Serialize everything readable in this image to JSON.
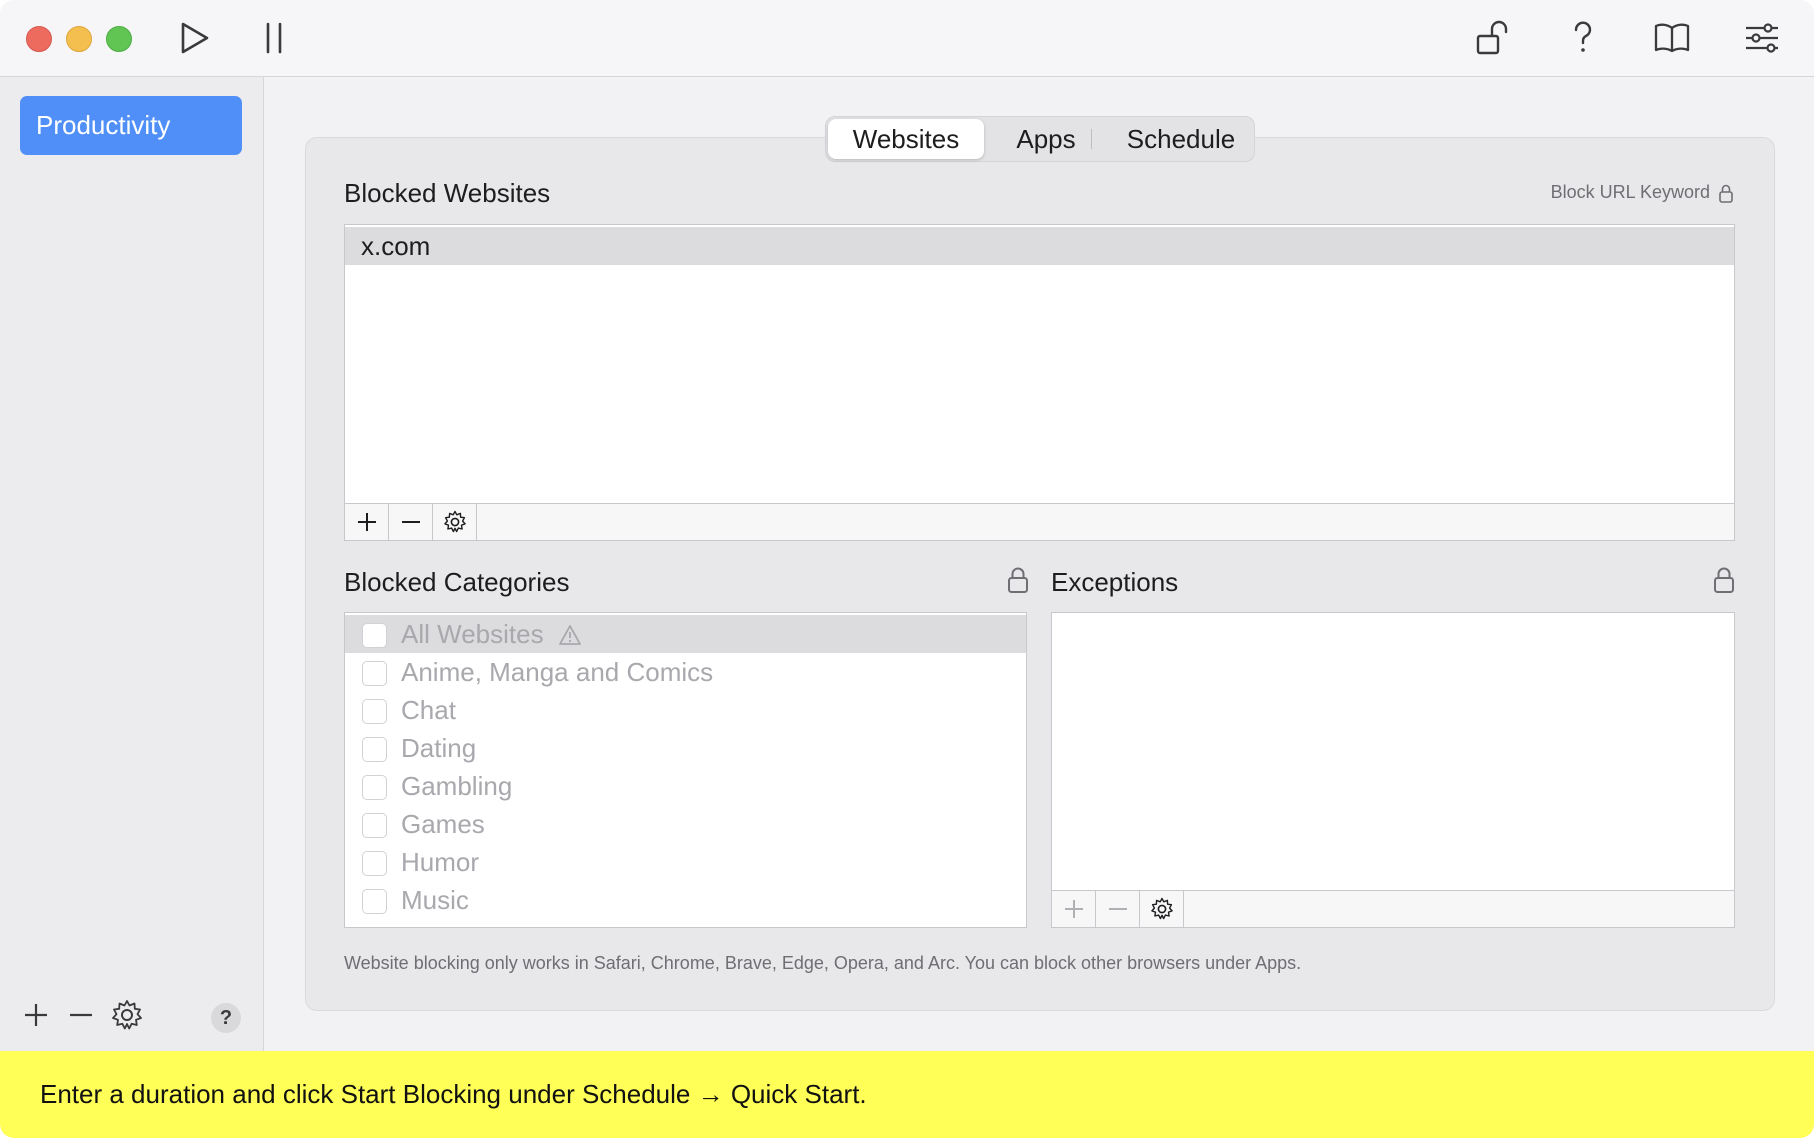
{
  "toolbar": {
    "icons": [
      "play-icon",
      "pause-icon",
      "unlock-icon",
      "help-icon",
      "book-icon",
      "sliders-icon"
    ]
  },
  "sidebar": {
    "items": [
      {
        "label": "Productivity",
        "selected": true
      }
    ],
    "footer_icons": [
      "plus-icon",
      "minus-icon",
      "gear-icon",
      "help-icon"
    ],
    "help_label": "?"
  },
  "tabs": {
    "items": [
      "Websites",
      "Apps",
      "Schedule"
    ],
    "active": "Websites"
  },
  "blocked_websites": {
    "title": "Blocked Websites",
    "keyword_label": "Block URL Keyword",
    "rows": [
      "x.com"
    ]
  },
  "blocked_categories": {
    "title": "Blocked Categories",
    "items": [
      "All Websites",
      "Anime, Manga and Comics",
      "Chat",
      "Dating",
      "Gambling",
      "Games",
      "Humor",
      "Music"
    ],
    "warning_icon": "warning-icon"
  },
  "exceptions": {
    "title": "Exceptions"
  },
  "footer_note": "Website blocking only works in Safari, Chrome, Brave, Edge, Opera, and Arc. You can block other browsers under Apps.",
  "banner": {
    "text": "Enter a duration and click Start Blocking under Schedule → Quick Start."
  },
  "colors": {
    "accent": "#4f8ff7",
    "banner": "#ffff57"
  }
}
